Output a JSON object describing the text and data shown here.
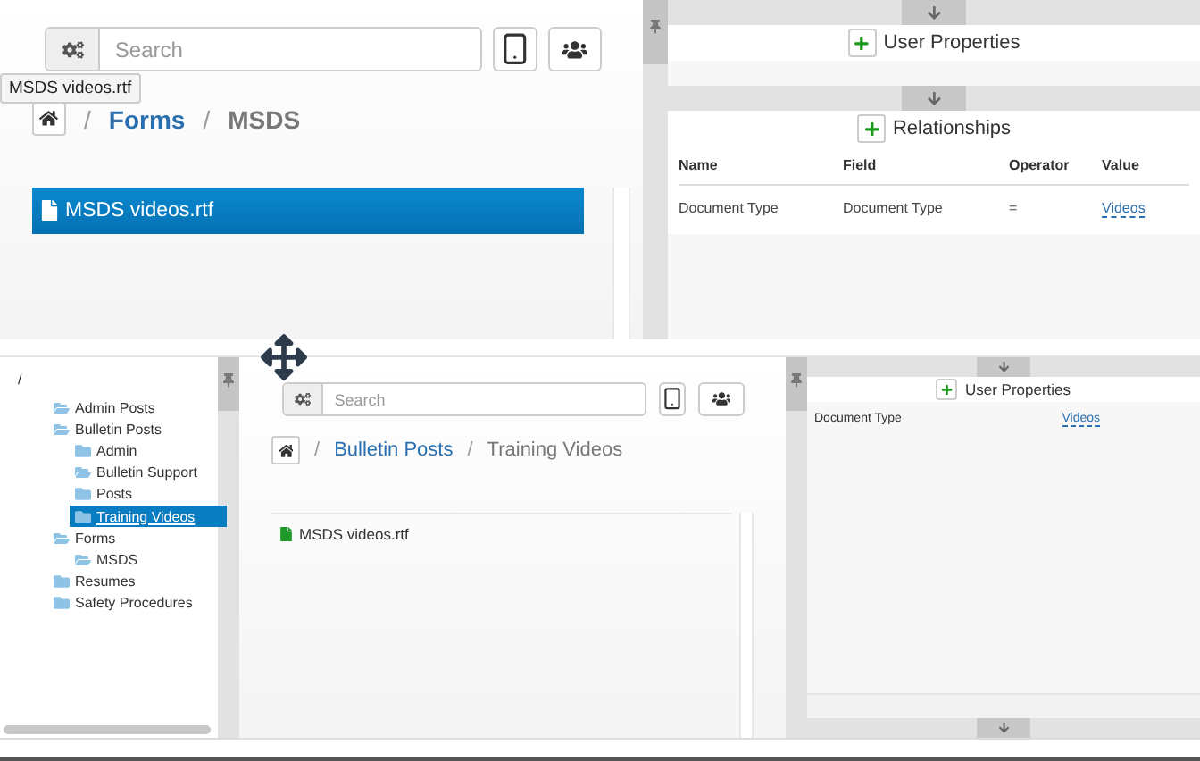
{
  "top_view": {
    "search": {
      "placeholder": "Search"
    },
    "tooltip": "MSDS videos.rtf",
    "breadcrumb": {
      "separator": "/",
      "items": [
        {
          "label": "Forms",
          "link": true
        },
        {
          "label": "MSDS",
          "link": false
        }
      ]
    },
    "files": [
      {
        "name": "MSDS videos.rtf",
        "selected": true
      }
    ],
    "user_properties": {
      "title": "User Properties"
    },
    "relationships": {
      "title": "Relationships",
      "columns": [
        "Name",
        "Field",
        "Operator",
        "Value"
      ],
      "rows": [
        [
          {
            "text": "Document Type",
            "link": false
          },
          {
            "text": "Document Type",
            "link": false
          },
          {
            "text": "=",
            "link": false
          },
          {
            "text": "Videos",
            "link": true
          }
        ]
      ]
    }
  },
  "bottom_view": {
    "tree": {
      "root": "/",
      "items": [
        {
          "label": "Admin Posts",
          "expanded": true,
          "selected": false
        },
        {
          "label": "Bulletin Posts",
          "expanded": true,
          "selected": false,
          "children": [
            {
              "label": "Admin",
              "expanded": false,
              "selected": false
            },
            {
              "label": "Bulletin Support",
              "expanded": true,
              "selected": false
            },
            {
              "label": "Posts",
              "expanded": false,
              "selected": false
            },
            {
              "label": "Training Videos",
              "expanded": false,
              "selected": true
            }
          ]
        },
        {
          "label": "Forms",
          "expanded": true,
          "selected": false,
          "children": [
            {
              "label": "MSDS",
              "expanded": true,
              "selected": false
            }
          ]
        },
        {
          "label": "Resumes",
          "expanded": false,
          "selected": false
        },
        {
          "label": "Safety Procedures",
          "expanded": false,
          "selected": false
        }
      ]
    },
    "search": {
      "placeholder": "Search"
    },
    "breadcrumb": {
      "separator": "/",
      "items": [
        {
          "label": "Bulletin Posts",
          "link": true
        },
        {
          "label": "Training Videos",
          "link": false
        }
      ]
    },
    "files": [
      {
        "name": "MSDS videos.rtf",
        "selected": false
      }
    ],
    "user_properties": {
      "title": "User Properties",
      "rows": [
        {
          "name": "Document Type",
          "value": "Videos"
        }
      ]
    }
  }
}
